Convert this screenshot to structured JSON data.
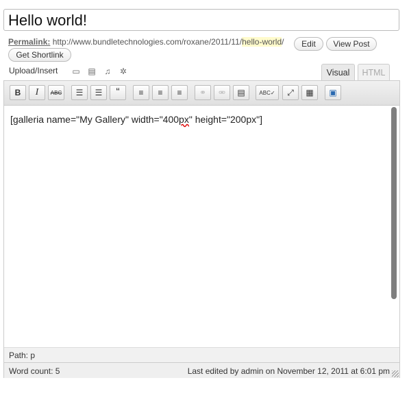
{
  "post": {
    "title": "Hello world!"
  },
  "permalink": {
    "label": "Permalink:",
    "base": "http://www.bundletechnologies.com/roxane/2011/11/",
    "slug": "hello-world",
    "trail": "/",
    "edit_label": "Edit",
    "view_label": "View Post",
    "shortlink_label": "Get Shortlink"
  },
  "upload": {
    "label": "Upload/Insert",
    "icons": [
      "image-icon",
      "video-icon",
      "audio-icon",
      "media-icon"
    ]
  },
  "tabs": {
    "visual": "Visual",
    "html": "HTML"
  },
  "toolbar": {
    "buttons": [
      {
        "name": "bold",
        "glyph": "B"
      },
      {
        "name": "italic",
        "glyph": "I"
      },
      {
        "name": "strikethrough",
        "glyph": "ABC"
      },
      {
        "name": "bullet-list",
        "glyph": "☰"
      },
      {
        "name": "numbered-list",
        "glyph": "☰"
      },
      {
        "name": "blockquote",
        "glyph": "“"
      },
      {
        "name": "align-left",
        "glyph": "≡"
      },
      {
        "name": "align-center",
        "glyph": "≡"
      },
      {
        "name": "align-right",
        "glyph": "≡"
      },
      {
        "name": "insert-link",
        "glyph": "⚭"
      },
      {
        "name": "remove-link",
        "glyph": "⚮"
      },
      {
        "name": "more-tag",
        "glyph": "▤"
      },
      {
        "name": "spellcheck",
        "glyph": "ABC✓"
      },
      {
        "name": "fullscreen",
        "glyph": "⤢"
      },
      {
        "name": "kitchen-sink",
        "glyph": "▦"
      },
      {
        "name": "gallery",
        "glyph": "▣"
      }
    ]
  },
  "editor": {
    "before": "[galleria name=\"My Gallery\" width=\"400",
    "misspelled": "px",
    "after": "\" height=\"200px\"]"
  },
  "path": {
    "text": "Path: p"
  },
  "status": {
    "word_count": "Word count: 5",
    "last_edited": "Last edited by admin on November 12, 2011 at 6:01 pm"
  }
}
